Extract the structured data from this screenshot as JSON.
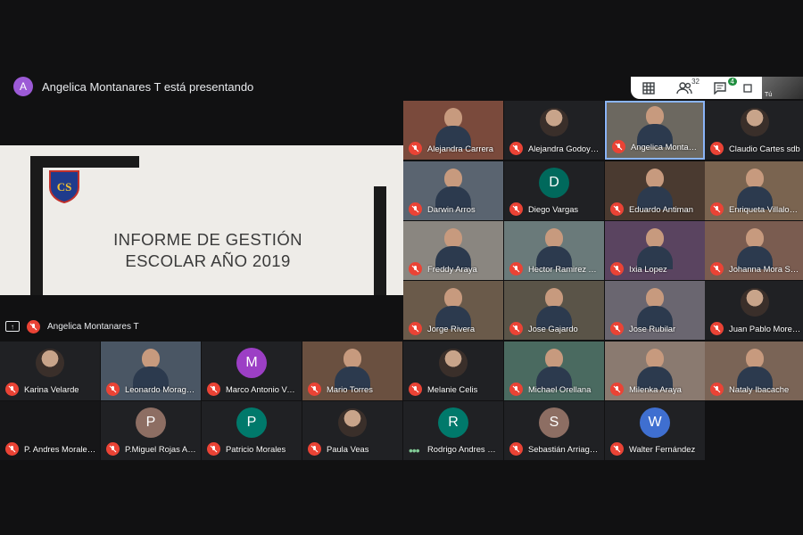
{
  "presenting": {
    "avatar_letter": "A",
    "text": "Angelica Montanares T está presentando"
  },
  "toolbar": {
    "participants_count": "32",
    "chat_count": "4",
    "self_label": "Tú"
  },
  "slide": {
    "title_line1": "INFORME DE GESTIÓN",
    "title_line2": "ESCOLAR AÑO 2019",
    "logo_letters": "CS"
  },
  "presenter_strip": {
    "name": "Angelica Montanares T"
  },
  "colors": {
    "accent_red": "#ea4335",
    "active_green": "#81c995"
  },
  "participants": [
    {
      "name": "Alejandra Carrera",
      "kind": "video",
      "bg": "#7a4a3c"
    },
    {
      "name": "Alejandra Godoy S...",
      "kind": "photo",
      "bg": "#202124"
    },
    {
      "name": "Angelica Montanar...",
      "kind": "video",
      "bg": "#6c6860",
      "active": true
    },
    {
      "name": "Claudio Cartes sdb",
      "kind": "photo",
      "bg": "#202124"
    },
    {
      "name": "Darwin Arros",
      "kind": "video",
      "bg": "#5a6470"
    },
    {
      "name": "Diego Vargas",
      "kind": "letter",
      "letter": "D",
      "avatar_color": "#00695c",
      "bg": "#202124"
    },
    {
      "name": "Eduardo Antiman",
      "kind": "video",
      "bg": "#4a3a30"
    },
    {
      "name": "Enriqueta Villalobos",
      "kind": "video",
      "bg": "#7a6450"
    },
    {
      "name": "Freddy Araya",
      "kind": "video",
      "bg": "#8a8680"
    },
    {
      "name": "Hector Ramirez Ar...",
      "kind": "video",
      "bg": "#6a7a7a"
    },
    {
      "name": "Ixia Lopez",
      "kind": "video",
      "bg": "#5a4460"
    },
    {
      "name": "Johanna Mora San...",
      "kind": "video",
      "bg": "#7a5c50"
    },
    {
      "name": "Jorge Rivera",
      "kind": "video",
      "bg": "#6a5a4a"
    },
    {
      "name": "Jose Gajardo",
      "kind": "video",
      "bg": "#5a5448"
    },
    {
      "name": "Jose Rubilar",
      "kind": "video",
      "bg": "#6a6670"
    },
    {
      "name": "Juan Pablo Moren...",
      "kind": "photo",
      "bg": "#202124"
    },
    {
      "name": "Karina Velarde",
      "kind": "photo",
      "bg": "#202124"
    },
    {
      "name": "Leonardo Moraga ...",
      "kind": "video",
      "bg": "#4a5664"
    },
    {
      "name": "Marco Antonio Ver...",
      "kind": "letter",
      "letter": "M",
      "avatar_color": "#9c3fc5",
      "bg": "#202124"
    },
    {
      "name": "Mario Torres",
      "kind": "video",
      "bg": "#6a5040"
    },
    {
      "name": "Melanie Celis",
      "kind": "photo",
      "bg": "#202124"
    },
    {
      "name": "Michael Orellana",
      "kind": "video",
      "bg": "#4a6a60"
    },
    {
      "name": "Milenka Araya",
      "kind": "video",
      "bg": "#8a7a70"
    },
    {
      "name": "Nataly Ibacache",
      "kind": "video",
      "bg": "#7a6456"
    },
    {
      "name": "P. Andres Morales ...",
      "kind": "blank",
      "bg": "#161618"
    },
    {
      "name": "P.Miguel Rojas An...",
      "kind": "letter",
      "letter": "P",
      "avatar_color": "#8d6e63",
      "bg": "#202124"
    },
    {
      "name": "Patricio Morales",
      "kind": "letter",
      "letter": "P",
      "avatar_color": "#00796b",
      "bg": "#202124"
    },
    {
      "name": "Paula Veas",
      "kind": "photo",
      "bg": "#202124"
    },
    {
      "name": "Rodrigo Andres Ca...",
      "kind": "letter",
      "letter": "R",
      "avatar_color": "#00796b",
      "bg": "#202124",
      "speaking": true
    },
    {
      "name": "Sebastián Arriagada",
      "kind": "letter",
      "letter": "S",
      "avatar_color": "#8d6e63",
      "bg": "#202124"
    },
    {
      "name": "Walter Fernández",
      "kind": "letter",
      "letter": "W",
      "avatar_color": "#3f6fd0",
      "bg": "#202124"
    }
  ]
}
